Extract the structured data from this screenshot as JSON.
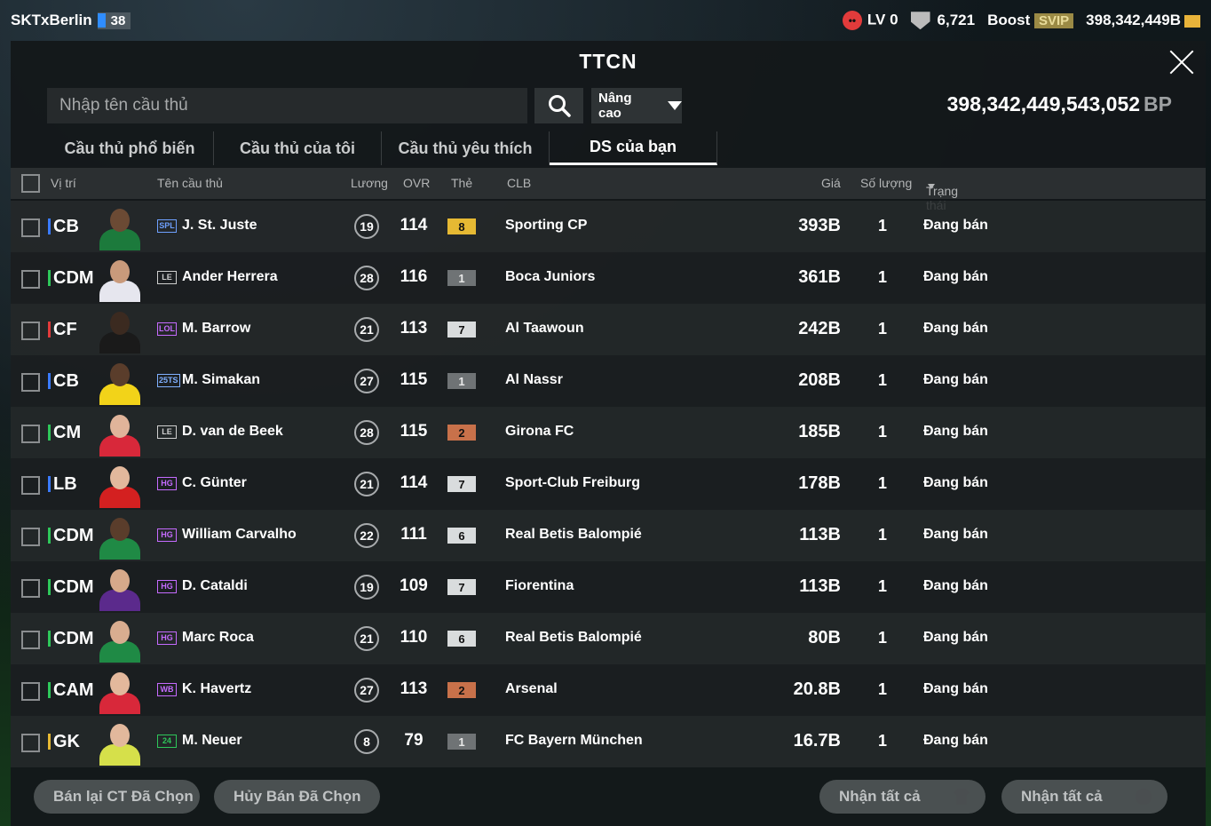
{
  "topbar": {
    "username": "SKTxBerlin",
    "level": "38",
    "lv_label": "LV 0",
    "trophies": "6,721",
    "boost_label": "Boost",
    "svip_label": "SVIP",
    "currency": "398,342,449B"
  },
  "panel": {
    "title": "TTCN",
    "search_placeholder": "Nhập tên cầu thủ",
    "advanced_label": "Nâng cao",
    "bp_value": "398,342,449,543,052",
    "bp_unit": "BP"
  },
  "tabs": [
    {
      "label": "Cầu thủ phổ biến",
      "active": false
    },
    {
      "label": "Cầu thủ của tôi",
      "active": false
    },
    {
      "label": "Cầu thủ yêu thích",
      "active": false
    },
    {
      "label": "DS của bạn",
      "active": true
    }
  ],
  "columns": {
    "position": "Vị trí",
    "name": "Tên cầu thủ",
    "wage": "Lương",
    "ovr": "OVR",
    "card": "Thẻ",
    "club": "CLB",
    "price": "Giá",
    "quantity": "Số lượng",
    "status": "Trạng thái"
  },
  "rows": [
    {
      "pos": "CB",
      "pos_color": "#3a7bff",
      "season": "SPL",
      "season_color": "#6ea0ff",
      "name": "J. St. Juste",
      "wage": "19",
      "ovr": "114",
      "grade": "8",
      "grade_color": "#e6b933",
      "club": "Sporting CP",
      "price": "393B",
      "qty": "1",
      "status": "Đang bán",
      "kit": "#1c7a3c",
      "skin": "#6b4a34"
    },
    {
      "pos": "CDM",
      "pos_color": "#2ec75a",
      "season": "LE",
      "season_color": "#cfcfcf",
      "name": "Ander Herrera",
      "wage": "28",
      "ovr": "116",
      "grade": "1",
      "grade_color": "#6f7375",
      "club": "Boca Juniors",
      "price": "361B",
      "qty": "1",
      "status": "Đang bán",
      "kit": "#e6e6ee",
      "skin": "#c99a7b"
    },
    {
      "pos": "CF",
      "pos_color": "#e23b3b",
      "season": "LOL",
      "season_color": "#c56bff",
      "name": "M. Barrow",
      "wage": "21",
      "ovr": "113",
      "grade": "7",
      "grade_color": "#d9dcdd",
      "club": "Al Taawoun",
      "price": "242B",
      "qty": "1",
      "status": "Đang bán",
      "kit": "#1a1a1a",
      "skin": "#3b2a20"
    },
    {
      "pos": "CB",
      "pos_color": "#3a7bff",
      "season": "25TS",
      "season_color": "#7fb0ff",
      "name": "M. Simakan",
      "wage": "27",
      "ovr": "115",
      "grade": "1",
      "grade_color": "#6f7375",
      "club": "Al Nassr",
      "price": "208B",
      "qty": "1",
      "status": "Đang bán",
      "kit": "#f2d319",
      "skin": "#5a3d2b"
    },
    {
      "pos": "CM",
      "pos_color": "#2ec75a",
      "season": "LE",
      "season_color": "#cfcfcf",
      "name": "D. van de Beek",
      "wage": "28",
      "ovr": "115",
      "grade": "2",
      "grade_color": "#c8714a",
      "club": "Girona FC",
      "price": "185B",
      "qty": "1",
      "status": "Đang bán",
      "kit": "#d8283a",
      "skin": "#e0b49a"
    },
    {
      "pos": "LB",
      "pos_color": "#3a7bff",
      "season": "HG",
      "season_color": "#c56bff",
      "name": "C. Günter",
      "wage": "21",
      "ovr": "114",
      "grade": "7",
      "grade_color": "#d9dcdd",
      "club": "Sport-Club Freiburg",
      "price": "178B",
      "qty": "1",
      "status": "Đang bán",
      "kit": "#d42020",
      "skin": "#e2b89c"
    },
    {
      "pos": "CDM",
      "pos_color": "#2ec75a",
      "season": "HG",
      "season_color": "#c56bff",
      "name": "William Carvalho",
      "wage": "22",
      "ovr": "111",
      "grade": "6",
      "grade_color": "#d9dcdd",
      "club": "Real Betis Balompié",
      "price": "113B",
      "qty": "1",
      "status": "Đang bán",
      "kit": "#1f8a45",
      "skin": "#5a3d2b"
    },
    {
      "pos": "CDM",
      "pos_color": "#2ec75a",
      "season": "HG",
      "season_color": "#c56bff",
      "name": "D. Cataldi",
      "wage": "19",
      "ovr": "109",
      "grade": "7",
      "grade_color": "#d9dcdd",
      "club": "Fiorentina",
      "price": "113B",
      "qty": "1",
      "status": "Đang bán",
      "kit": "#5b2a8c",
      "skin": "#d6a98a"
    },
    {
      "pos": "CDM",
      "pos_color": "#2ec75a",
      "season": "HG",
      "season_color": "#c56bff",
      "name": "Marc Roca",
      "wage": "21",
      "ovr": "110",
      "grade": "6",
      "grade_color": "#d9dcdd",
      "club": "Real Betis Balompié",
      "price": "80B",
      "qty": "1",
      "status": "Đang bán",
      "kit": "#1f8a45",
      "skin": "#d9ad90"
    },
    {
      "pos": "CAM",
      "pos_color": "#2ec75a",
      "season": "WB",
      "season_color": "#c56bff",
      "name": "K. Havertz",
      "wage": "27",
      "ovr": "113",
      "grade": "2",
      "grade_color": "#c8714a",
      "club": "Arsenal",
      "price": "20.8B",
      "qty": "1",
      "status": "Đang bán",
      "kit": "#d8283a",
      "skin": "#e3b89c"
    },
    {
      "pos": "GK",
      "pos_color": "#e6b933",
      "season": "24",
      "season_color": "#2ec75a",
      "name": "M. Neuer",
      "wage": "8",
      "ovr": "79",
      "grade": "1",
      "grade_color": "#6f7375",
      "club": "FC Bayern München",
      "price": "16.7B",
      "qty": "1",
      "status": "Đang bán",
      "kit": "#d6e04a",
      "skin": "#e2b89c"
    }
  ],
  "footer": {
    "resell_selected": "Bán lại CT Đã Chọn",
    "cancel_selected": "Hủy Bán Đã Chọn",
    "claim_all_1": "Nhận tất cả",
    "claim_all_2": "Nhận tất cả"
  }
}
